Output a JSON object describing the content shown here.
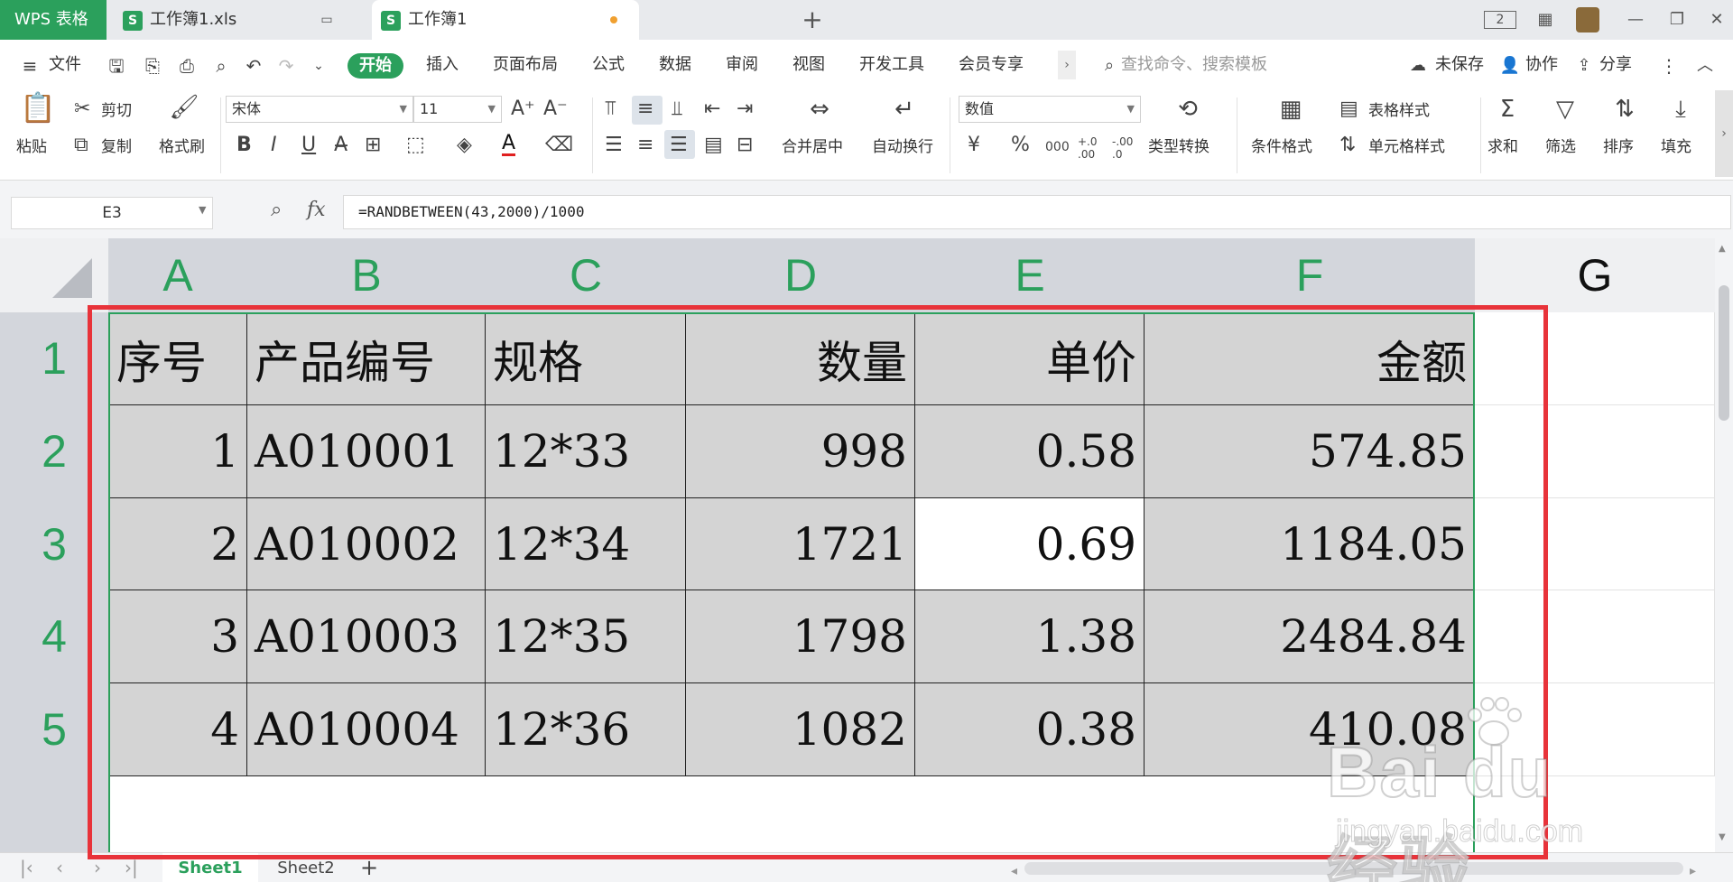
{
  "titlebar": {
    "app_tab": "WPS 表格",
    "tabs": [
      {
        "label": "工作簿1.xls",
        "active": false
      },
      {
        "label": "工作簿1",
        "active": true
      }
    ],
    "new_tab": "+"
  },
  "menubar": {
    "file": "文件",
    "items": [
      "开始",
      "插入",
      "页面布局",
      "公式",
      "数据",
      "审阅",
      "视图",
      "开发工具",
      "会员专享"
    ],
    "active": "开始",
    "search_placeholder": "查找命令、搜索模板",
    "unsaved": "未保存",
    "collab": "协作",
    "share": "分享"
  },
  "ribbon": {
    "paste": "粘贴",
    "cut": "剪切",
    "copy": "复制",
    "format_painter": "格式刷",
    "font_name": "宋体",
    "font_size": "11",
    "merge_center": "合并居中",
    "wrap_text": "自动换行",
    "number_format": "数值",
    "type_convert": "类型转换",
    "cond_format": "条件格式",
    "table_style": "表格样式",
    "cell_style": "单元格样式",
    "sum": "求和",
    "filter": "筛选",
    "sort": "排序",
    "fill": "填充",
    "currency": "¥",
    "percent": "%",
    "thousands": "000",
    "dec_inc": "+.0 .00",
    "dec_dec": "-.00 .0"
  },
  "formula_bar": {
    "name_box": "E3",
    "fx": "fx",
    "formula": "=RANDBETWEEN(43,2000)/1000"
  },
  "sheet": {
    "columns": [
      "A",
      "B",
      "C",
      "D",
      "E",
      "F",
      "G"
    ],
    "rows": [
      "1",
      "2",
      "3",
      "4",
      "5"
    ],
    "header": [
      "序号",
      "产品编号",
      "规格",
      "数量",
      "单价",
      "金额"
    ],
    "data": [
      [
        "1",
        "A010001",
        "12*33",
        "998",
        "0.58",
        "574.85"
      ],
      [
        "2",
        "A010002",
        "12*34",
        "1721",
        "0.69",
        "1184.05"
      ],
      [
        "3",
        "A010003",
        "12*35",
        "1798",
        "1.38",
        "2484.84"
      ],
      [
        "4",
        "A010004",
        "12*36",
        "1082",
        "0.38",
        "410.08"
      ]
    ]
  },
  "sheetbar": {
    "tabs": [
      "Sheet1",
      "Sheet2"
    ],
    "active": "Sheet1",
    "add": "+"
  },
  "watermark": {
    "brand": "Bai du 经验",
    "url": "jingyan.baidu.com"
  },
  "colors": {
    "accent": "#2ba05c",
    "annotation": "#e8333a",
    "cell_fill": "#d4d4d4"
  }
}
